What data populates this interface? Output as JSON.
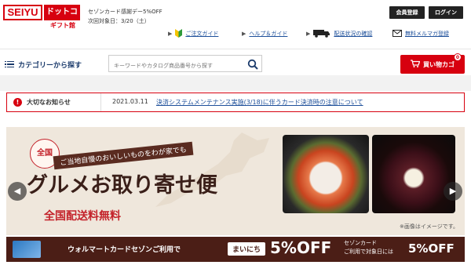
{
  "logo": {
    "seiyu": "SEIYU",
    "dotcom": "ドットコム",
    "gift": "ギフト館"
  },
  "promo": {
    "line1": "セゾンカード感謝デー5%OFF",
    "line2": "次回対象日：3/20（土）"
  },
  "header_buttons": {
    "member": "会員登録",
    "login": "ログイン"
  },
  "nav": [
    {
      "label": "ご注文ガイド",
      "icon": "beginner-mark-icon"
    },
    {
      "label": "ヘルプ＆ガイド",
      "icon": "none"
    },
    {
      "label": "配送状況の確認",
      "icon": "truck-icon"
    },
    {
      "label": "無料メルマガ登録",
      "icon": "mail-icon"
    }
  ],
  "search": {
    "category_label": "カテゴリーから探す",
    "placeholder": "キーワードやカタログ商品番号から探す"
  },
  "cart": {
    "label": "買い物カゴ",
    "count": "0"
  },
  "notice": {
    "badge": "大切なお知らせ",
    "date": "2021.03.11",
    "message": "決済システムメンテナンス実施(3/18)に伴うカード決済時の注意について"
  },
  "banner": {
    "badge": "全国",
    "subtitle": "ご当地自慢のおいしいものをわが家でも",
    "title": "グルメお取り寄せ便",
    "free_shipping": "全国配送料無料",
    "note": "※画像はイメージです。"
  },
  "strip": {
    "text": "ウォルマートカードセゾンご利用で",
    "daily": "まいにち",
    "off": "5%OFF",
    "saison_line1": "セゾンカード",
    "saison_line2": "ご利用で対象日には",
    "off2": "5%OFF"
  },
  "colors": {
    "brand_red": "#d7000f",
    "link_blue": "#1d4f9a",
    "banner_brown": "#4b1e16"
  }
}
